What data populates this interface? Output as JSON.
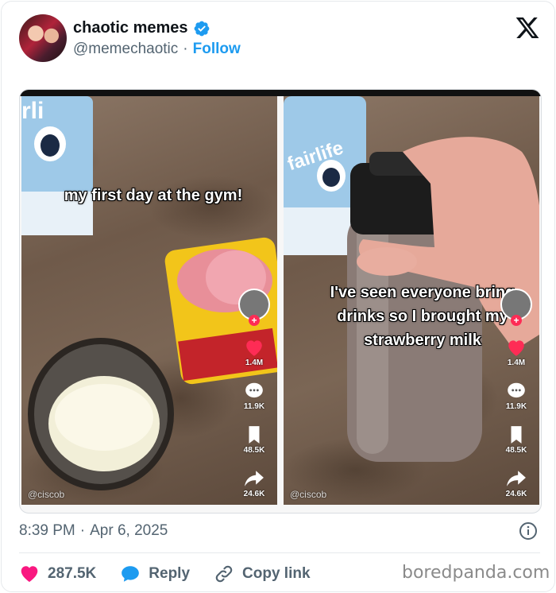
{
  "author": {
    "display_name": "chaotic memes",
    "handle": "@memechaotic",
    "separator": "·",
    "follow_label": "Follow",
    "verified": true,
    "verified_color": "#1d9bf0"
  },
  "media": {
    "left_panel": {
      "caption": "my first day at the gym!",
      "stats": {
        "likes": "1.4M",
        "comments": "11.9K",
        "saves": "48.5K",
        "shares": "24.6K"
      },
      "watermark": "@ciscob"
    },
    "right_panel": {
      "caption": "I've seen everyone bring drinks so I brought my strawberry milk",
      "stats": {
        "likes": "1.4M",
        "comments": "11.9K",
        "saves": "48.5K",
        "shares": "24.6K"
      },
      "watermark": "@ciscob"
    }
  },
  "post": {
    "time": "8:39 PM",
    "separator": "·",
    "date": "Apr 6, 2025"
  },
  "actions": {
    "like_count": "287.5K",
    "reply_label": "Reply",
    "copy_link_label": "Copy link"
  },
  "credit": "boredpanda.com",
  "colors": {
    "like": "#f91880",
    "reply": "#1d9bf0",
    "link": "#1d9bf0",
    "muted": "#536471"
  }
}
